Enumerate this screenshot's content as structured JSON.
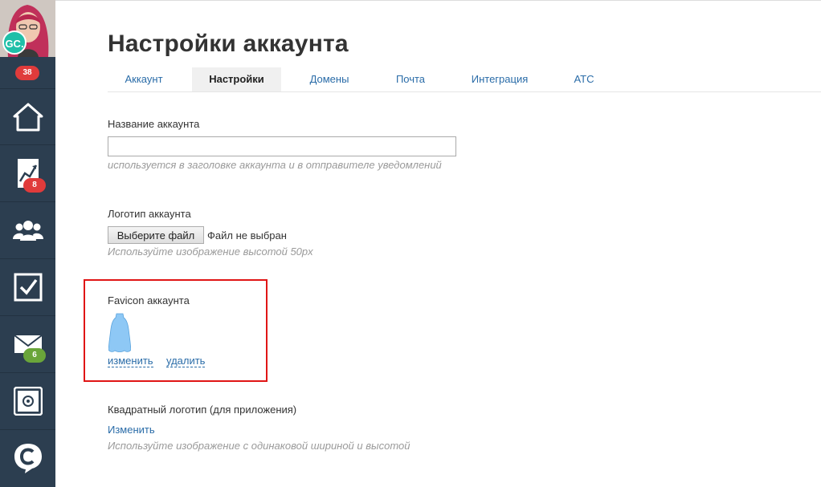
{
  "sidebar": {
    "avatar_initials": "GC.",
    "top_badge": "38",
    "items": [
      {
        "name": "home-icon",
        "badge": ""
      },
      {
        "name": "chart-icon",
        "badge": "8"
      },
      {
        "name": "users-icon",
        "badge": ""
      },
      {
        "name": "checkbox-icon",
        "badge": ""
      },
      {
        "name": "mail-icon",
        "badge": "6"
      },
      {
        "name": "safe-icon",
        "badge": ""
      },
      {
        "name": "logo-c-icon",
        "badge": ""
      }
    ],
    "colors": {
      "bg": "#2c3e50",
      "badge_red": "#e03b3b",
      "badge_green": "#6aa53a",
      "initials_bg": "#1fbfa8"
    }
  },
  "page": {
    "title": "Настройки аккаунта",
    "tabs": [
      "Аккаунт",
      "Настройки",
      "Домены",
      "Почта",
      "Интеграция",
      "АТС"
    ],
    "active_tab": "Настройки"
  },
  "form": {
    "account_name": {
      "label": "Название аккаунта",
      "value": "",
      "hint": "используется в заголовке аккаунта и в отправителе уведомлений"
    },
    "logo": {
      "label": "Логотип аккаунта",
      "button": "Выберите файл",
      "status": "Файл не выбран",
      "hint": "Используйте изображение высотой 50px"
    },
    "favicon": {
      "label": "Favicon аккаунта",
      "change_link": "изменить",
      "delete_link": "удалить"
    },
    "square_logo": {
      "label": "Квадратный логотип (для приложения)",
      "change_link": "Изменить",
      "hint": "Используйте изображение с одинаковой шириной и высотой"
    }
  },
  "colors": {
    "link": "#2a6ca8",
    "highlight": "#e01515",
    "favicon_fill": "#8ec8f5"
  }
}
